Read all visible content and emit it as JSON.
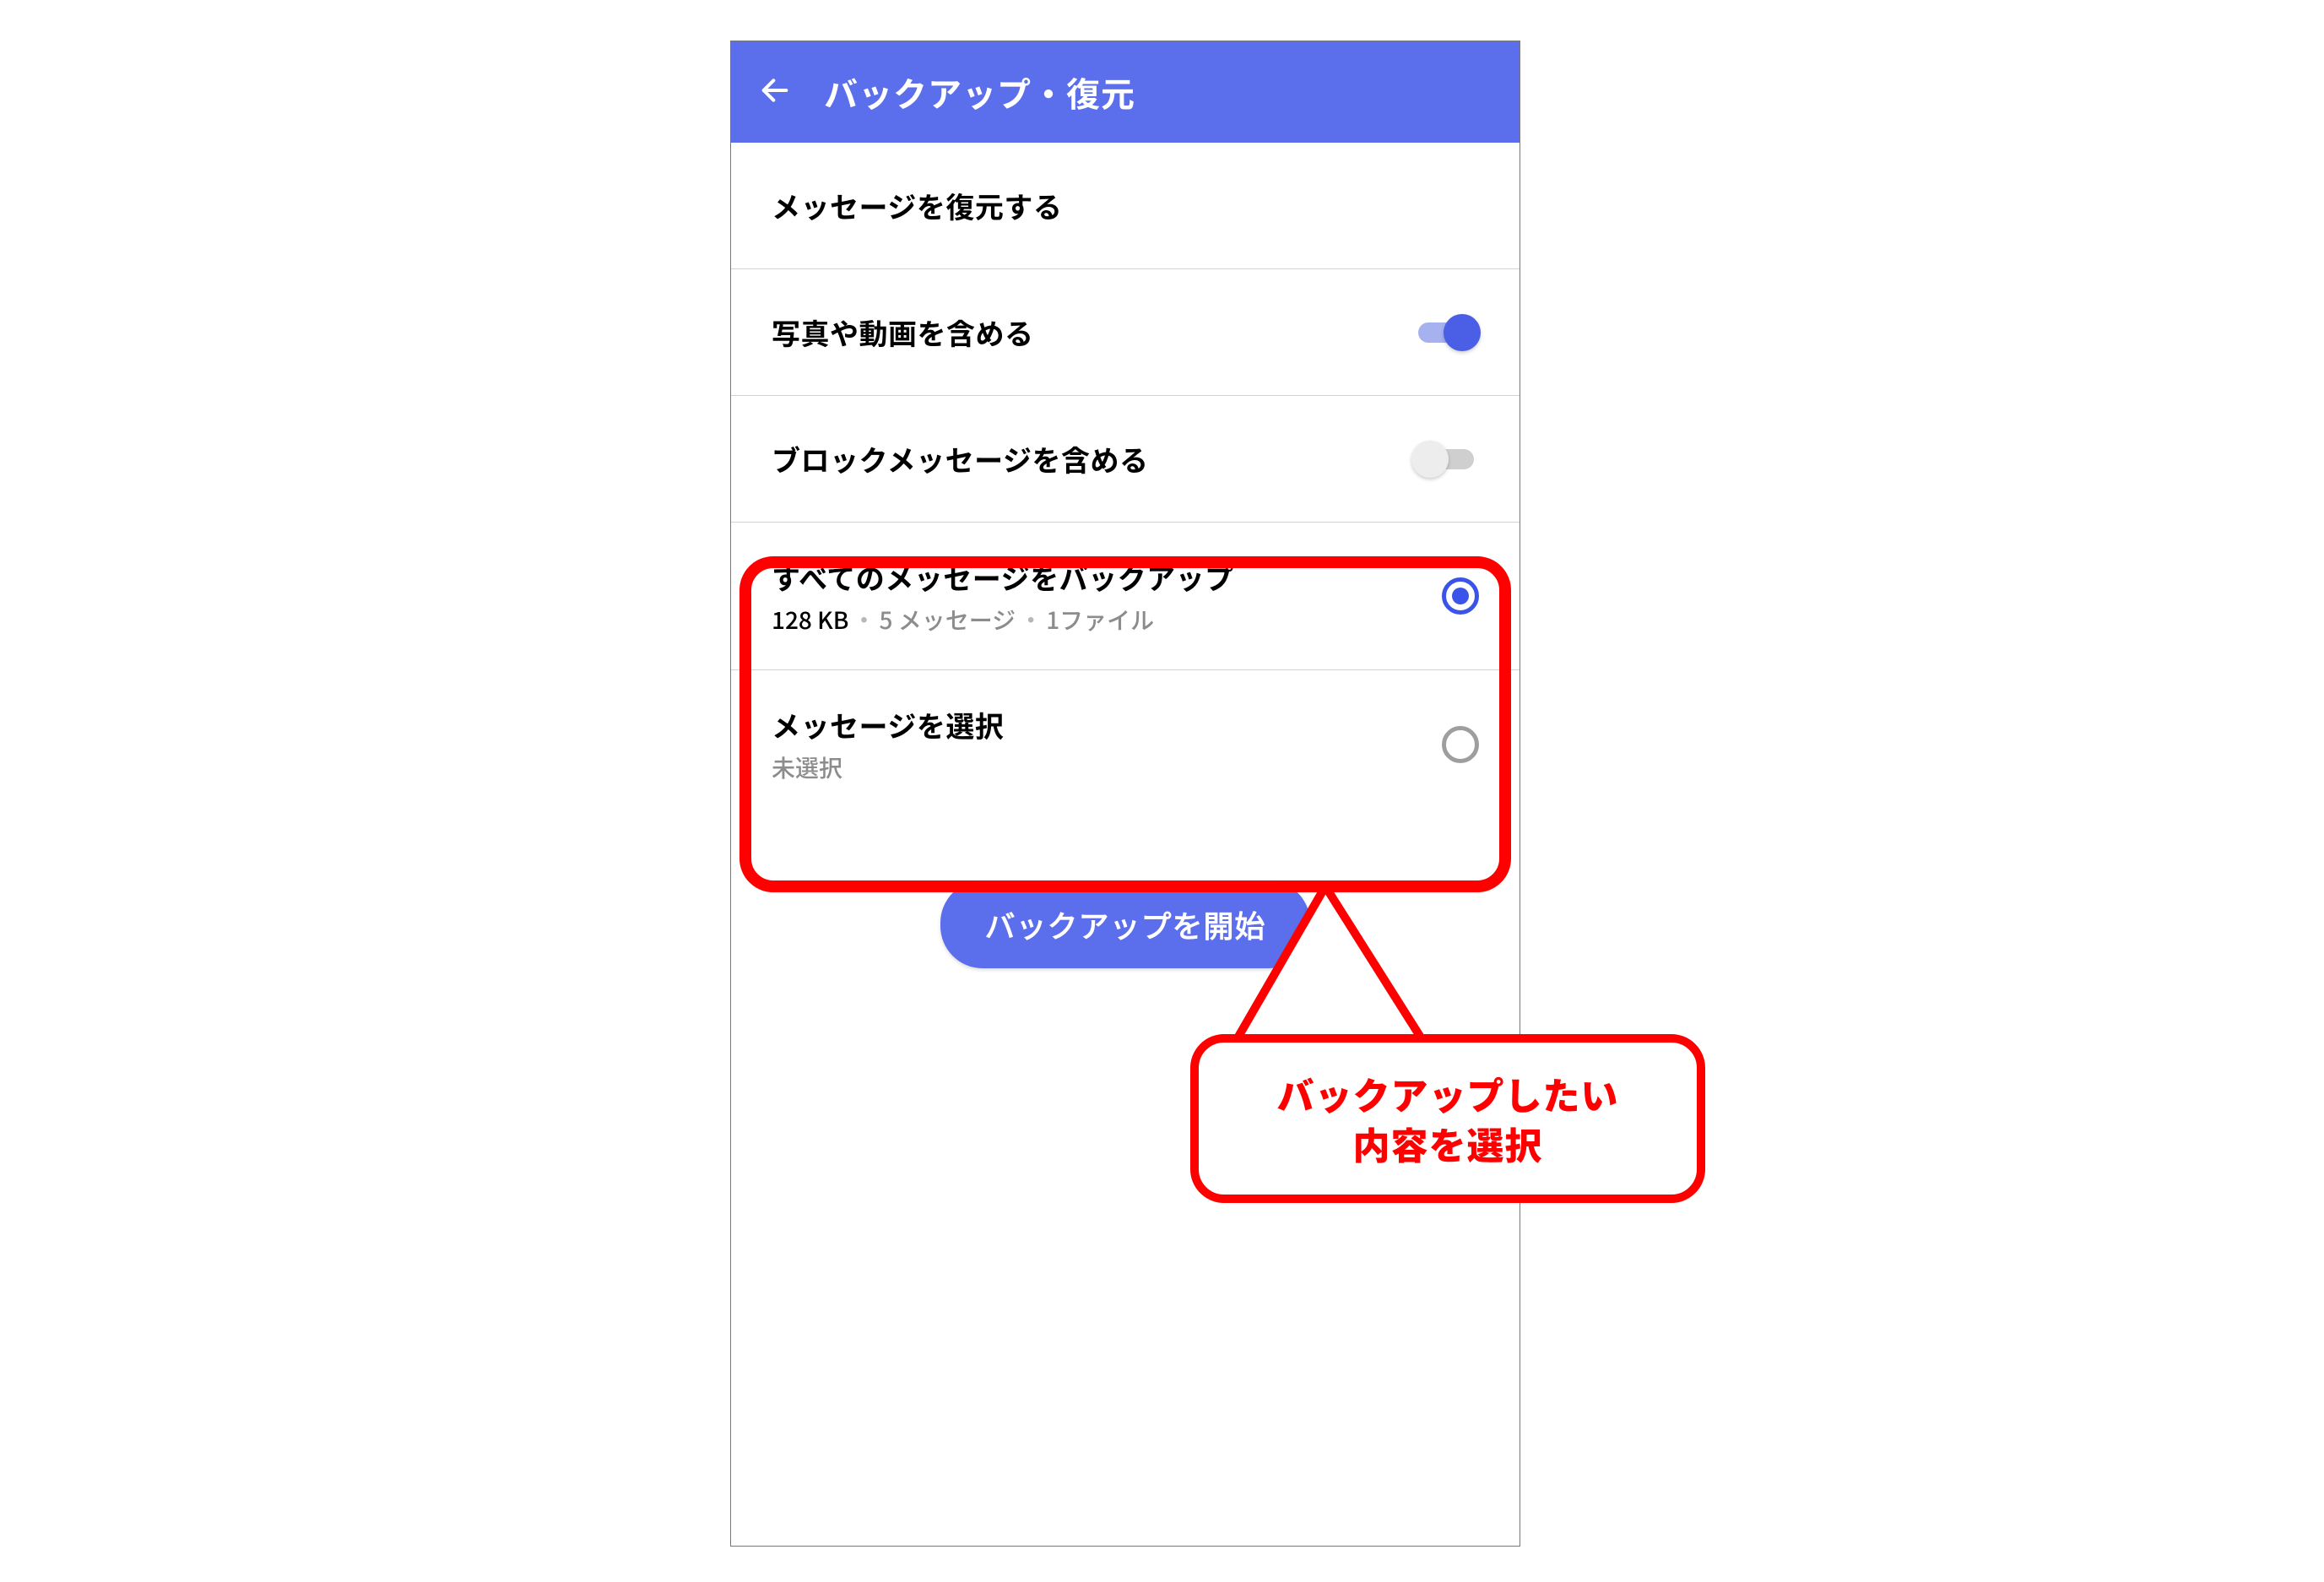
{
  "appbar": {
    "title": "バックアップ・復元"
  },
  "rows": {
    "restore": {
      "label": "メッセージを復元する"
    },
    "include_media": {
      "label": "写真や動画を含める",
      "enabled": true
    },
    "include_blocked": {
      "label": "ブロックメッセージを含める",
      "enabled": false
    },
    "backup_all": {
      "label": "すべてのメッセージをバックアップ",
      "size": "128 KB",
      "messages": "5 メッセージ",
      "files": "1ファイル",
      "selected": true
    },
    "select_messages": {
      "label": "メッセージを選択",
      "sub": "未選択",
      "selected": false
    }
  },
  "button": {
    "start": "バックアップを開始"
  },
  "annotation": {
    "callout": "バックアップしたい\n内容を選択"
  },
  "colors": {
    "accent": "#5b6eeb",
    "highlight": "#ff0000"
  }
}
